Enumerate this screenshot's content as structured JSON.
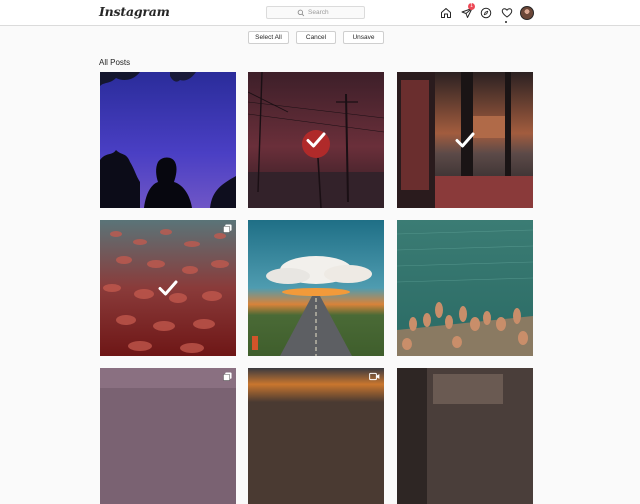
{
  "app": {
    "logo": "Instagram",
    "search_placeholder": "Search",
    "notification_count": "1"
  },
  "actions": {
    "select_all": "Select All",
    "cancel": "Cancel",
    "unsave": "Unsave"
  },
  "section": {
    "title": "All Posts"
  },
  "posts": [
    {
      "scene": "night-silhouette",
      "selected": false,
      "type": "image"
    },
    {
      "scene": "stop-sign-powerlines",
      "selected": true,
      "type": "image"
    },
    {
      "scene": "sunset-window",
      "selected": true,
      "type": "image"
    },
    {
      "scene": "red-texture",
      "selected": true,
      "type": "carousel"
    },
    {
      "scene": "road-sunset",
      "selected": false,
      "type": "image"
    },
    {
      "scene": "sea-swimmers",
      "selected": false,
      "type": "image"
    },
    {
      "scene": "purple-sky",
      "selected": false,
      "type": "carousel"
    },
    {
      "scene": "orange-horizon",
      "selected": false,
      "type": "video"
    },
    {
      "scene": "dim-room",
      "selected": false,
      "type": "image"
    }
  ],
  "colors": {
    "accent_badge": "#ed4956",
    "text": "#262626",
    "border": "#dbdbdb",
    "background": "#fafafa"
  }
}
